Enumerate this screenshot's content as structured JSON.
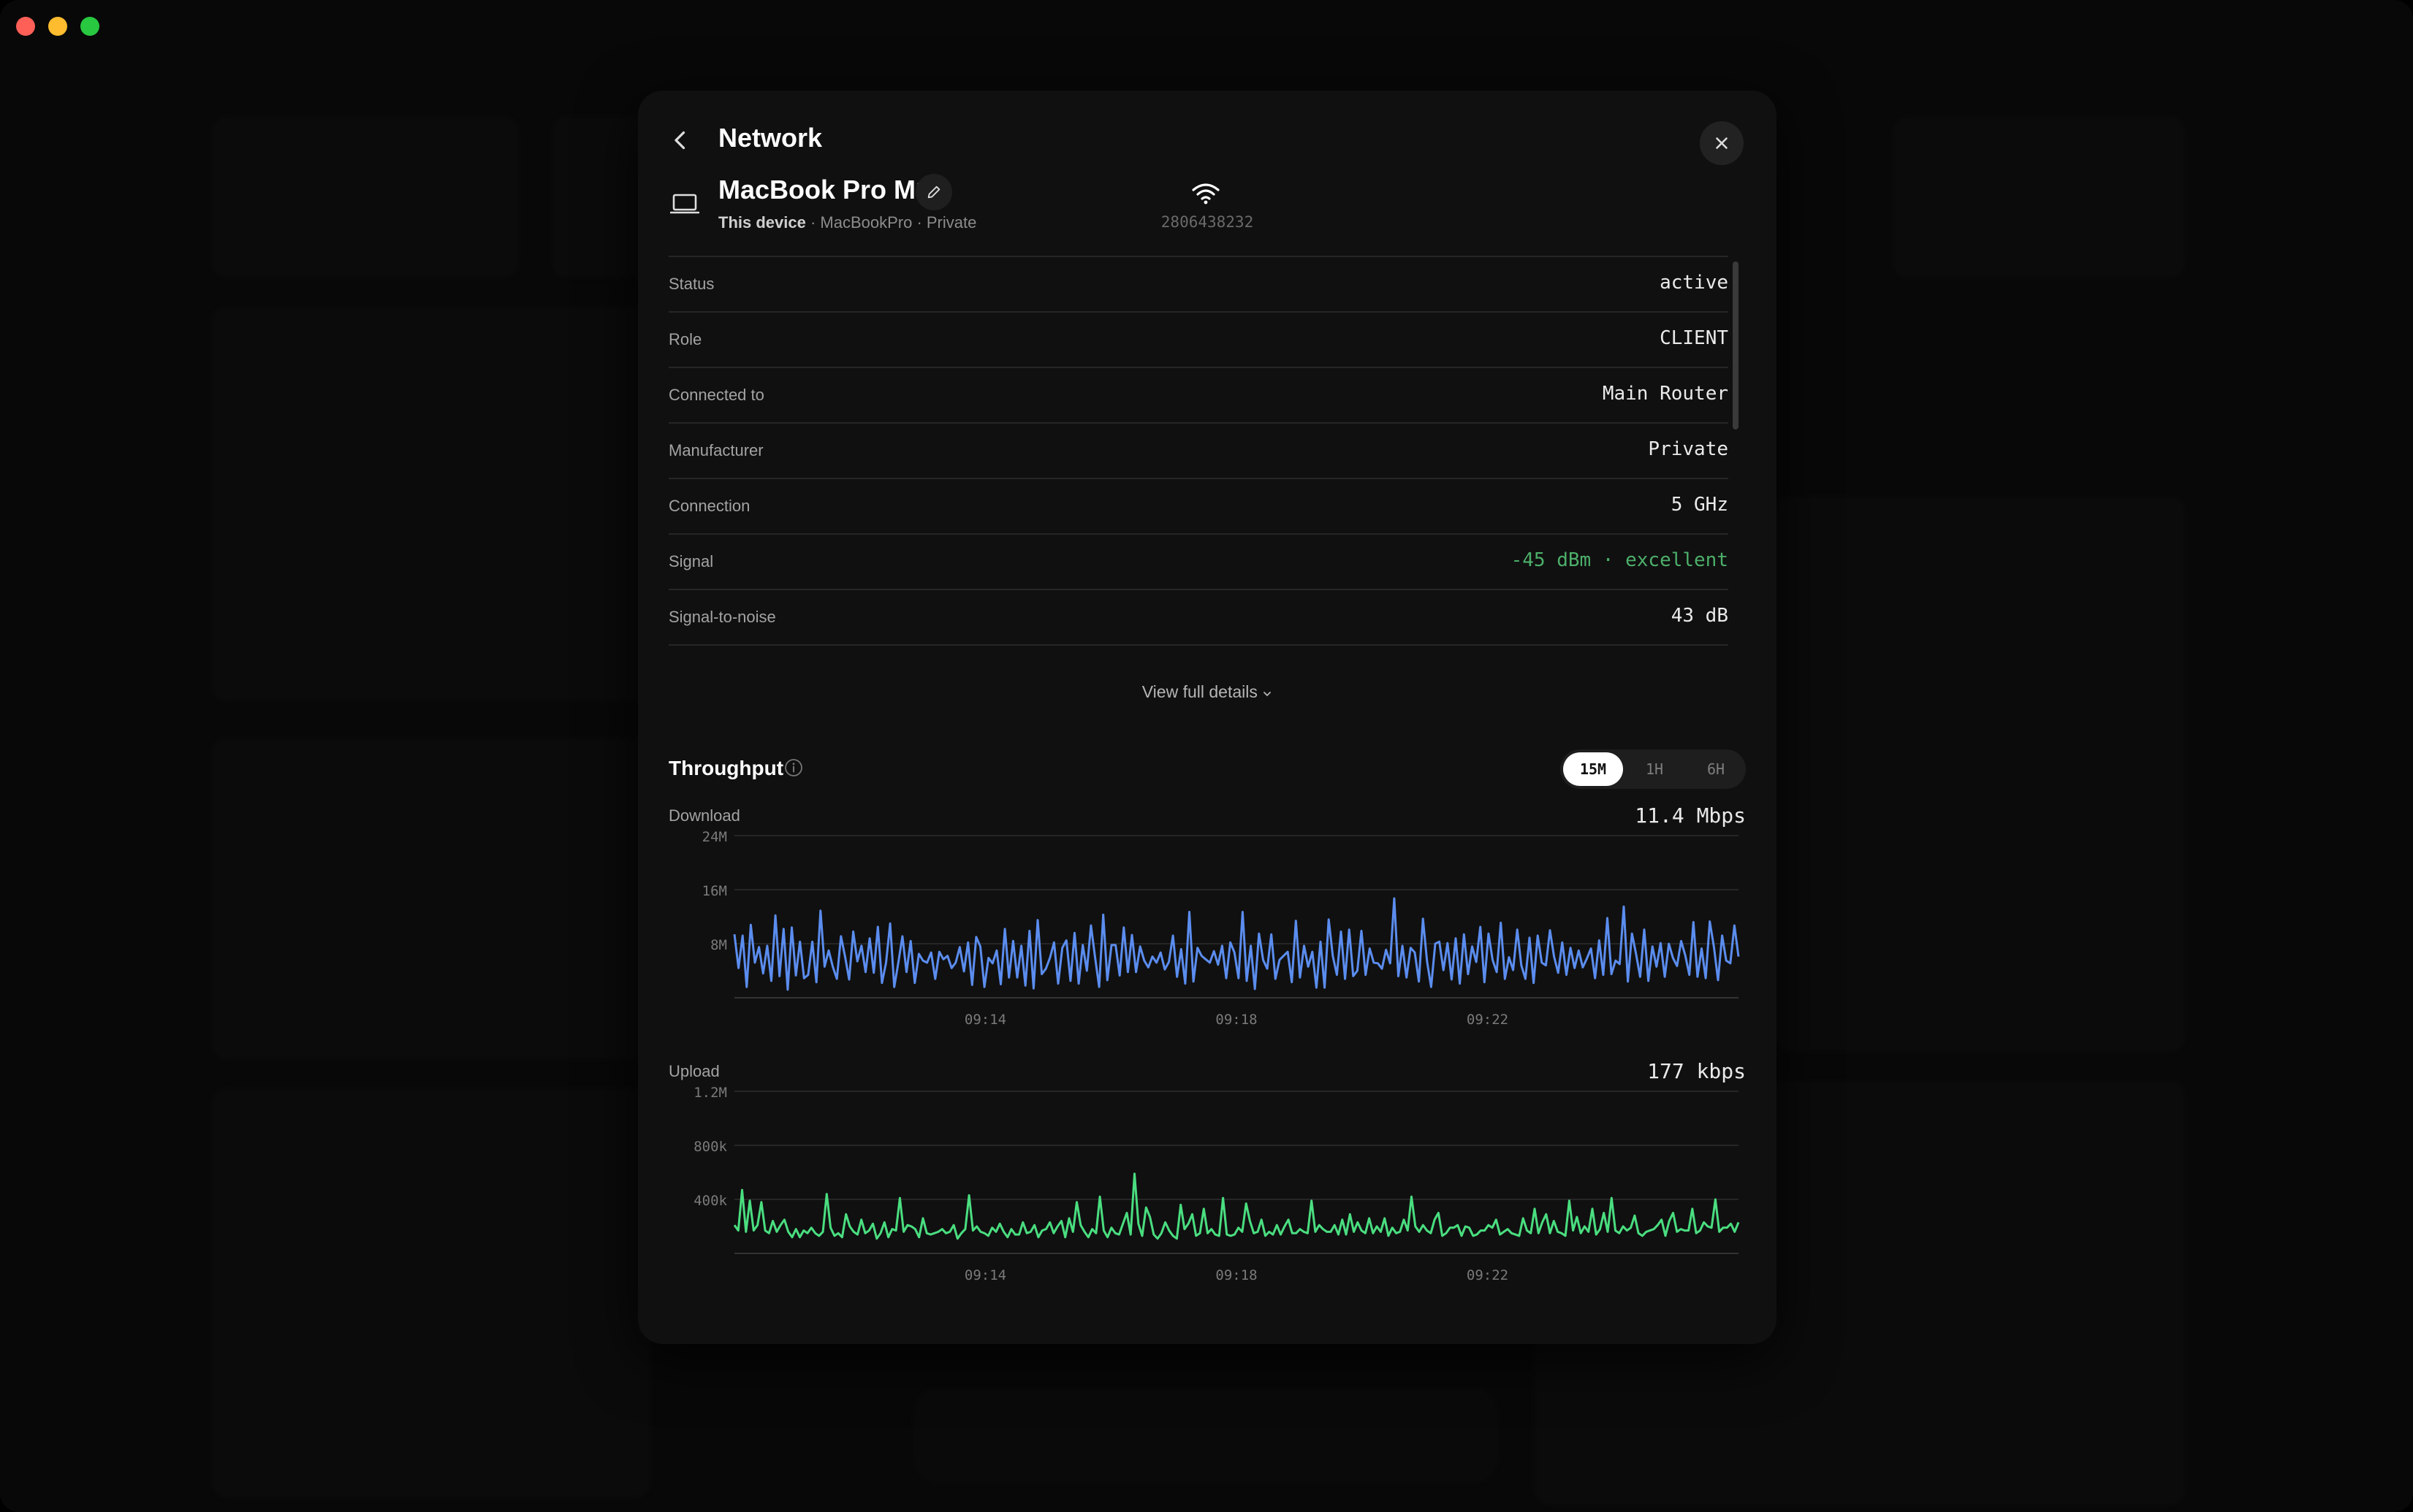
{
  "window": {
    "traffic_lights": [
      "#fe5f57",
      "#febc2e",
      "#28c840"
    ]
  },
  "modal": {
    "title": "Network",
    "device": {
      "name": "MacBook Pro M1",
      "subtitle_strong": "This device",
      "subtitle_rest": " · MacBookPro · Private",
      "id": "2806438232"
    },
    "details": [
      {
        "key": "Status",
        "value": "active",
        "tone": "normal"
      },
      {
        "key": "Role",
        "value": "CLIENT",
        "tone": "normal"
      },
      {
        "key": "Connected to",
        "value": "Main Router",
        "tone": "normal"
      },
      {
        "key": "Manufacturer",
        "value": "Private",
        "tone": "normal"
      },
      {
        "key": "Connection",
        "value": "5 GHz",
        "tone": "normal"
      },
      {
        "key": "Signal",
        "value": "-45 dBm · excellent",
        "tone": "good"
      },
      {
        "key": "Signal-to-noise",
        "value": "43 dB",
        "tone": "normal"
      }
    ],
    "view_full_label": "View full details",
    "throughput": {
      "title": "Throughput",
      "ranges": [
        "15M",
        "1H",
        "6H"
      ],
      "selected_range": "15M"
    }
  },
  "chart_data": [
    {
      "type": "line",
      "title": "Download",
      "current_value": "11.4 Mbps",
      "color": "#5b8def",
      "yticks": [
        "24M",
        "16M",
        "8M"
      ],
      "ylim": [
        0,
        24000000
      ],
      "x_tick_labels": [
        "09:14",
        "09:18",
        "09:22"
      ],
      "series": [
        {
          "values": [
            9.4,
            4.4,
            9.2,
            1.6,
            10.8,
            5.2,
            7.5,
            3.6,
            7.7,
            2.5,
            12.2,
            3.2,
            10.2,
            1.2,
            10.4,
            3.3,
            8.3,
            2.9,
            3.4,
            8.3,
            2.3,
            12.9,
            4.6,
            7,
            4.6,
            2.8,
            9.1,
            6.1,
            2.7,
            9.8,
            5.4,
            7.7,
            3.8,
            8.8,
            3.7,
            10.5,
            2.2,
            5.2,
            11,
            1.6,
            5.2,
            9.1,
            3.8,
            8.4,
            2.2,
            6.5,
            5.5,
            5.2,
            6.7,
            2.8,
            6.8,
            5.7,
            6.2,
            4.4,
            5.2,
            7.5,
            3.9,
            8.2,
            1.9,
            9,
            7.6,
            1.6,
            5.9,
            5.1,
            7,
            2,
            10.2,
            3,
            8.4,
            3,
            7.7,
            1.8,
            9.9,
            1.4,
            11.5,
            3.5,
            4.3,
            5.9,
            8.2,
            2.1,
            7.4,
            8.5,
            2.5,
            9.6,
            2.1,
            7.8,
            4,
            10.7,
            6,
            1.6,
            12.3,
            2.6,
            7.8,
            7.8,
            3.3,
            10.4,
            3.8,
            9.3,
            3.8,
            7.6,
            5.5,
            4.5,
            6.1,
            5.2,
            6.7,
            4.2,
            5.3,
            9.2,
            3.1,
            7.2,
            2.1,
            12.7,
            2.4,
            7.4,
            6.2,
            5.7,
            5.2,
            6.9,
            4.9,
            7.7,
            2.9,
            8.2,
            6.7,
            2.9,
            12.7,
            2.5,
            7.7,
            1.3,
            9.5,
            5.6,
            4.3,
            9.4,
            2.8,
            5.6,
            6.2,
            6.8,
            2.3,
            11.4,
            3,
            7.7,
            4.6,
            6.8,
            1.5,
            8.3,
            1.5,
            11.6,
            6.2,
            3.4,
            9.8,
            2.8,
            10.1,
            3.2,
            4,
            9.9,
            3.4,
            7.3,
            5.2,
            5.1,
            4.3,
            7.1,
            5.1,
            14.7,
            3.2,
            7.7,
            3,
            7.4,
            6.7,
            2.4,
            11.7,
            5.4,
            1.6,
            8,
            8.3,
            4.1,
            8.1,
            2.7,
            8.8,
            2.1,
            9.4,
            3.5,
            7.6,
            5.3,
            10.5,
            2.3,
            9.5,
            5.6,
            3.8,
            11.1,
            2.8,
            6,
            4.1,
            10.1,
            4.8,
            2.8,
            8.9,
            2.2,
            9.2,
            5.2,
            4.8,
            10,
            6.1,
            3.7,
            8.2,
            3.4,
            7.4,
            4.4,
            7,
            4.5,
            5.8,
            7.3,
            2.9,
            8.5,
            3.4,
            11.8,
            3.5,
            5.5,
            5,
            13.5,
            2.4,
            9.5,
            6.5,
            3.1,
            10.1,
            2.5,
            7.6,
            4.6,
            8.1,
            3.1,
            8,
            5.9,
            4.7,
            8.4,
            6.3,
            3.4,
            11.2,
            3.1,
            7.3,
            2.9,
            11.3,
            7.5,
            2.6,
            9.2,
            5.5,
            5.1,
            10.7,
            6.1
          ]
        }
      ]
    },
    {
      "type": "line",
      "title": "Upload",
      "current_value": "177 kbps",
      "color": "#4ade80",
      "yticks": [
        "1.2M",
        "800k",
        "400k"
      ],
      "ylim": [
        0,
        1200000
      ],
      "x_tick_labels": [
        "09:14",
        "09:18",
        "09:22"
      ],
      "series": [
        {
          "values": [
            210,
            170,
            470,
            160,
            390,
            170,
            210,
            380,
            170,
            150,
            240,
            160,
            210,
            250,
            160,
            120,
            180,
            120,
            170,
            150,
            190,
            150,
            130,
            160,
            440,
            190,
            130,
            150,
            120,
            290,
            200,
            160,
            140,
            250,
            150,
            170,
            220,
            110,
            150,
            230,
            120,
            180,
            170,
            410,
            160,
            210,
            200,
            180,
            120,
            260,
            150,
            140,
            150,
            160,
            180,
            150,
            160,
            210,
            110,
            150,
            180,
            430,
            170,
            200,
            160,
            150,
            130,
            190,
            160,
            220,
            160,
            120,
            180,
            140,
            140,
            230,
            150,
            160,
            210,
            120,
            170,
            180,
            230,
            150,
            200,
            240,
            120,
            260,
            160,
            380,
            210,
            160,
            120,
            180,
            150,
            420,
            170,
            120,
            190,
            150,
            140,
            220,
            300,
            140,
            590,
            220,
            130,
            340,
            270,
            140,
            110,
            150,
            230,
            170,
            130,
            110,
            360,
            180,
            220,
            290,
            130,
            150,
            330,
            150,
            180,
            140,
            130,
            410,
            140,
            130,
            140,
            190,
            160,
            370,
            240,
            150,
            160,
            250,
            130,
            160,
            140,
            210,
            140,
            200,
            250,
            150,
            150,
            180,
            160,
            150,
            390,
            160,
            210,
            180,
            160,
            160,
            210,
            140,
            250,
            140,
            290,
            160,
            230,
            170,
            150,
            260,
            150,
            200,
            160,
            260,
            130,
            190,
            150,
            160,
            250,
            170,
            420,
            200,
            160,
            210,
            170,
            150,
            250,
            300,
            130,
            150,
            190,
            190,
            210,
            130,
            200,
            190,
            130,
            140,
            170,
            170,
            210,
            190,
            250,
            140,
            160,
            180,
            150,
            140,
            130,
            260,
            170,
            150,
            330,
            150,
            230,
            290,
            150,
            240,
            160,
            150,
            130,
            390,
            170,
            270,
            150,
            200,
            160,
            330,
            140,
            180,
            300,
            160,
            410,
            170,
            150,
            200,
            170,
            190,
            280,
            150,
            130,
            160,
            170,
            180,
            210,
            250,
            130,
            240,
            300,
            160,
            180,
            170,
            170,
            330,
            150,
            170,
            230,
            200,
            190,
            400,
            160,
            190,
            190,
            220,
            160,
            230
          ]
        }
      ]
    }
  ]
}
